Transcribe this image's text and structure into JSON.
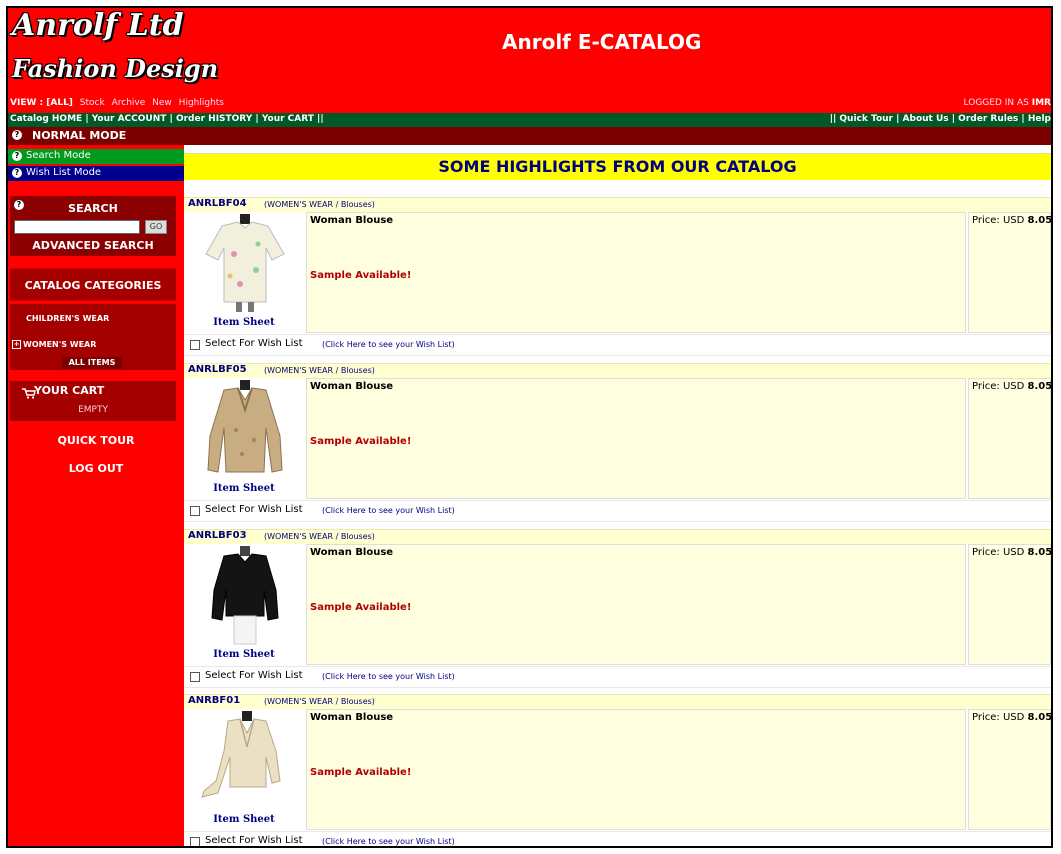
{
  "header": {
    "logo_line1": "Anrolf Ltd",
    "logo_line2": "Fashion Design",
    "title": "Anrolf E-CATALOG",
    "view_label": "VIEW : [ALL]",
    "view_links": [
      "Stock",
      "Archive",
      "New",
      "Highlights"
    ],
    "logged_in_label": "LOGGED IN AS",
    "logged_in_user": "IMR"
  },
  "nav": {
    "left": "Catalog HOME | Your ACCOUNT | Order HISTORY | Your CART ||",
    "right": "|| Quick Tour | About Us | Order Rules | Help"
  },
  "mode": {
    "label": "NORMAL MODE"
  },
  "sidebar": {
    "search_mode": "Search Mode",
    "wish_mode": "Wish List Mode",
    "search_title": "SEARCH",
    "search_value": "",
    "go_label": "GO",
    "advanced_search": "ADVANCED SEARCH",
    "categories_title": "CATALOG CATEGORIES",
    "categories": {
      "children": "CHILDREN'S WEAR",
      "womens": "WOMEN'S WEAR",
      "all_items": "ALL ITEMS"
    },
    "cart_title": "YOUR CART",
    "cart_status": "EMPTY",
    "quick_tour": "QUICK TOUR",
    "log_out": "LOG OUT"
  },
  "main": {
    "banner": "SOME HIGHLIGHTS FROM OUR CATALOG",
    "items": [
      {
        "code": "ANRLBF04",
        "category": "(WOMEN'S WEAR / Blouses)",
        "title": "Woman Blouse",
        "sample": "Sample Available!",
        "price_label": "Price: USD",
        "price_value": "8.05",
        "item_sheet": "Item Sheet",
        "wish_label": "Select For Wish List",
        "wish_link": "(Click Here to see your Wish List)",
        "garment_color": "#f2f0dc"
      },
      {
        "code": "ANRLBF05",
        "category": "(WOMEN'S WEAR / Blouses)",
        "title": "Woman Blouse",
        "sample": "Sample Available!",
        "price_label": "Price: USD",
        "price_value": "8.05",
        "item_sheet": "Item Sheet",
        "wish_label": "Select For Wish List",
        "wish_link": "(Click Here to see your Wish List)",
        "garment_color": "#c9ad82"
      },
      {
        "code": "ANRLBF03",
        "category": "(WOMEN'S WEAR / Blouses)",
        "title": "Woman Blouse",
        "sample": "Sample Available!",
        "price_label": "Price: USD",
        "price_value": "8.05",
        "item_sheet": "Item Sheet",
        "wish_label": "Select For Wish List",
        "wish_link": "(Click Here to see your Wish List)",
        "garment_color": "#141414"
      },
      {
        "code": "ANRBF01",
        "category": "(WOMEN'S WEAR / Blouses)",
        "title": "Woman Blouse",
        "sample": "Sample Available!",
        "price_label": "Price: USD",
        "price_value": "8.05",
        "item_sheet": "Item Sheet",
        "wish_label": "Select For Wish List",
        "wish_link": "(Click Here to see your Wish List)",
        "garment_color": "#ece0c4"
      }
    ]
  },
  "colors": {
    "brand_red": "#fe0000",
    "nav_green": "#005a28",
    "mode_dark_red": "#7b0000",
    "banner_yellow": "#ffff00",
    "link_navy": "#000080"
  }
}
